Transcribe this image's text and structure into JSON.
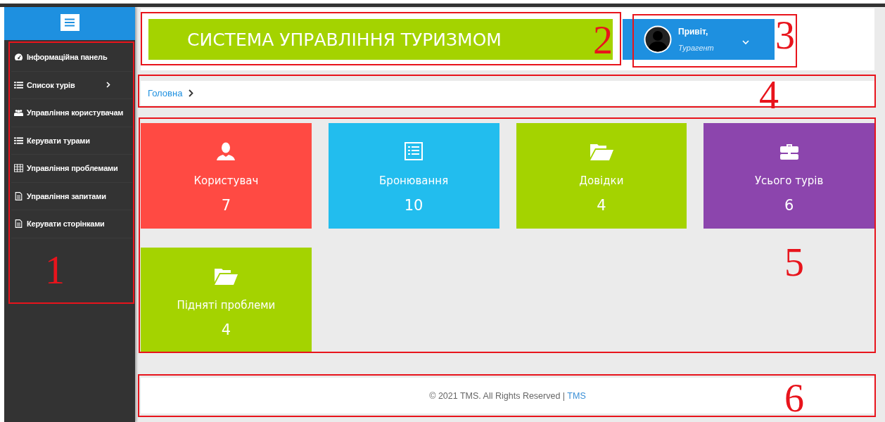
{
  "sidebar": {
    "annotation": "1",
    "items": [
      {
        "label": "Інформаційна панель",
        "has_submenu": false
      },
      {
        "label": "Список турів",
        "has_submenu": true
      },
      {
        "label": "Управління користувачам",
        "has_submenu": false
      },
      {
        "label": "Керувати турами",
        "has_submenu": false
      },
      {
        "label": "Управління проблемами",
        "has_submenu": false
      },
      {
        "label": "Управління запитами",
        "has_submenu": false
      },
      {
        "label": "Керувати сторінками",
        "has_submenu": false
      }
    ]
  },
  "header": {
    "title": "СИСТЕМА УПРАВЛІННЯ ТУРИЗМОМ",
    "title_annotation": "2",
    "user": {
      "greeting": "Привіт,",
      "role": "Турагент",
      "annotation": "3"
    }
  },
  "breadcrumb": {
    "items": [
      "Головна"
    ],
    "annotation": "4"
  },
  "tiles": {
    "annotation": "5",
    "items": [
      {
        "label": "Користувач",
        "count": "7",
        "color": "#ff4a43"
      },
      {
        "label": "Бронювання",
        "count": "10",
        "color": "#22bdee"
      },
      {
        "label": "Довідки",
        "count": "4",
        "color": "#a4d300"
      },
      {
        "label": "Усього турів",
        "count": "6",
        "color": "#8c45ad"
      },
      {
        "label": "Підняті проблеми",
        "count": "4",
        "color": "#a4d300"
      }
    ]
  },
  "footer": {
    "text": "© 2021 TMS. All Rights Reserved | ",
    "link": "TMS",
    "annotation": "6"
  }
}
